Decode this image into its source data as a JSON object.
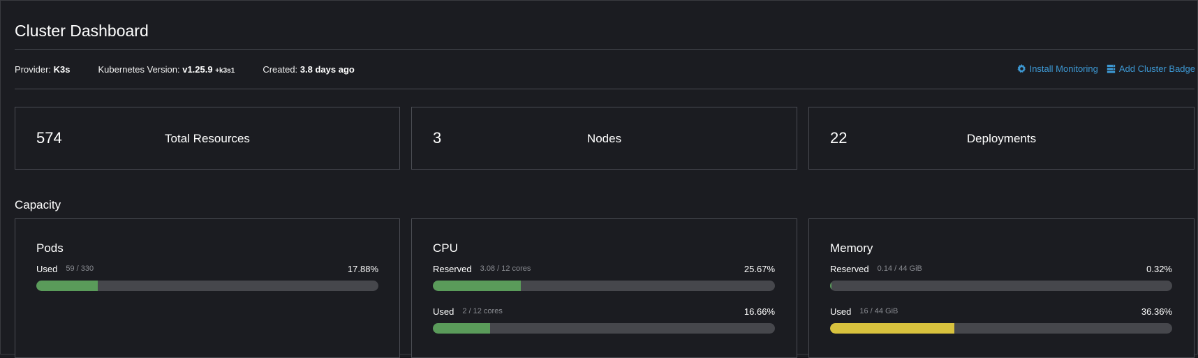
{
  "header": {
    "title": "Cluster Dashboard",
    "provider_label": "Provider:",
    "provider_value": "K3s",
    "version_label": "Kubernetes Version:",
    "version_value": "v1.25.9",
    "version_suffix": "+k3s1",
    "created_label": "Created:",
    "created_value": "3.8 days ago",
    "install_monitoring": "Install Monitoring",
    "add_cluster_badge": "Add Cluster Badge",
    "install_icon": "gear-icon",
    "badge_icon": "server-icon"
  },
  "stats": [
    {
      "value": "574",
      "label": "Total Resources"
    },
    {
      "value": "3",
      "label": "Nodes"
    },
    {
      "value": "22",
      "label": "Deployments"
    }
  ],
  "capacity": {
    "title": "Capacity",
    "cards": [
      {
        "title": "Pods",
        "gauges": [
          {
            "label": "Used",
            "detail": "59 / 330",
            "percent_text": "17.88%",
            "fraction": 0.1788,
            "color": "#5a9b5a"
          }
        ]
      },
      {
        "title": "CPU",
        "gauges": [
          {
            "label": "Reserved",
            "detail": "3.08 / 12 cores",
            "percent_text": "25.67%",
            "fraction": 0.2567,
            "color": "#5a9b5a"
          },
          {
            "label": "Used",
            "detail": "2 / 12 cores",
            "percent_text": "16.66%",
            "fraction": 0.1666,
            "color": "#5a9b5a"
          }
        ]
      },
      {
        "title": "Memory",
        "gauges": [
          {
            "label": "Reserved",
            "detail": "0.14 / 44 GiB",
            "percent_text": "0.32%",
            "fraction": 0.0032,
            "color": "#5a9b5a"
          },
          {
            "label": "Used",
            "detail": "16 / 44 GiB",
            "percent_text": "36.36%",
            "fraction": 0.3636,
            "color": "#d8c23e"
          }
        ]
      }
    ]
  },
  "colors": {
    "background": "#1b1c21",
    "link": "#3d98d3",
    "bar_track": "#46474c",
    "bar_green": "#5a9b5a",
    "bar_yellow": "#d8c23e"
  }
}
